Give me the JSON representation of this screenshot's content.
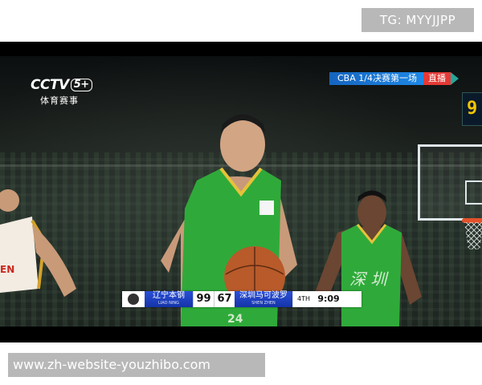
{
  "watermark": {
    "tg": "TG: MYYJJPP"
  },
  "channel": {
    "name": "CCTV",
    "suffix": "5+",
    "subtitle": "体育赛事"
  },
  "banner": {
    "title": "CBA 1/4决赛第一场",
    "live": "直播"
  },
  "shot_clock": {
    "value": "9"
  },
  "scoreboard": {
    "home": {
      "name": "辽宁本钢",
      "pinyin": "LIAO NING",
      "score": "99"
    },
    "away": {
      "name": "深圳马可波罗",
      "pinyin": "SHEN ZHEN",
      "score": "67"
    },
    "period": "4TH",
    "clock": "9:09"
  },
  "jerseys": {
    "center_number": "24"
  },
  "footer": {
    "url": "www.zh-website-youzhibo.com"
  },
  "colors": {
    "away_jersey": "#2faa3a",
    "home_jersey": "#f3ece2",
    "banner_blue": "#1565c0",
    "live_red": "#e53935"
  }
}
